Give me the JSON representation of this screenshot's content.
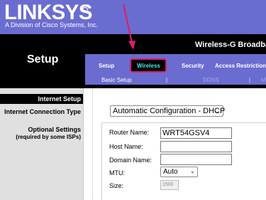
{
  "header": {
    "brand": "LINKSYS",
    "tagline": "A Division of Cisco Systems, Inc.",
    "product": "Wireless-G Broadband"
  },
  "left_panel": {
    "title": "Setup"
  },
  "nav": {
    "tabs": [
      {
        "label": "Setup"
      },
      {
        "label": "Wireless"
      },
      {
        "label": "Security"
      },
      {
        "label": "Access Restrictions"
      }
    ],
    "subtabs": [
      {
        "label": "Basic Setup"
      },
      {
        "label": "|"
      },
      {
        "label": "DDNS"
      },
      {
        "label": "|"
      },
      {
        "label": "M"
      }
    ]
  },
  "sidebar": {
    "section": "Internet Setup",
    "connection_type": "Internet Connection Type",
    "optional_1": "Optional Settings",
    "optional_2": "(required by some ISPs)"
  },
  "form": {
    "connection_value": "Automatic Configuration - DHCP",
    "router_name_label": "Router Name:",
    "router_name_value": "WRT54GSV4",
    "host_name_label": "Host Name:",
    "domain_name_label": "Domain Name:",
    "mtu_label": "MTU:",
    "mtu_value": "Auto",
    "size_label": "Size:",
    "size_value": "1500"
  },
  "colors": {
    "brand_purple": "#6a6cd0",
    "highlight": "#d8206b",
    "active_tab_text": "#4fe3e3"
  }
}
